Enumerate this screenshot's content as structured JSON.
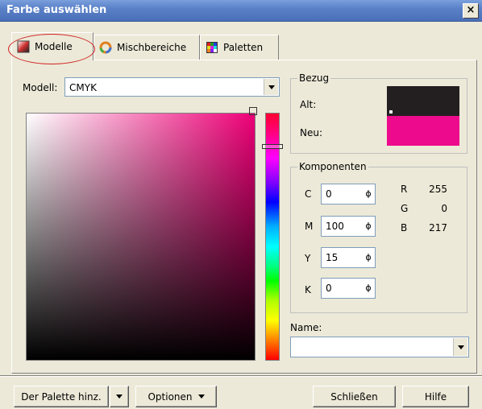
{
  "window": {
    "title": "Farbe auswählen",
    "close_glyph": "×"
  },
  "tabs": [
    {
      "label": "Modelle",
      "icon": "color-model-icon",
      "active": true
    },
    {
      "label": "Mischbereiche",
      "icon": "color-wheel-icon",
      "active": false
    },
    {
      "label": "Paletten",
      "icon": "palette-grid-icon",
      "active": false
    }
  ],
  "model": {
    "label": "Modell:",
    "selected": "CMYK"
  },
  "reference": {
    "group_label": "Bezug",
    "old_label": "Alt:",
    "new_label": "Neu:",
    "old_color": "#231f20",
    "new_color": "#ee0a8c"
  },
  "components": {
    "group_label": "Komponenten",
    "cmyk": [
      {
        "label": "C",
        "value": "0"
      },
      {
        "label": "M",
        "value": "100"
      },
      {
        "label": "Y",
        "value": "15"
      },
      {
        "label": "K",
        "value": "0"
      }
    ],
    "rgb": [
      {
        "label": "R",
        "value": "255"
      },
      {
        "label": "G",
        "value": "0"
      },
      {
        "label": "B",
        "value": "217"
      }
    ],
    "spin_glyph": "ɸ"
  },
  "name_field": {
    "label": "Name:",
    "value": ""
  },
  "buttons": {
    "add_to_palette": "Der Palette hinz.",
    "options": "Optionen",
    "close": "Schließen",
    "help": "Hilfe"
  },
  "colors": {
    "titlebar": "#5a81c8",
    "dialog_bg": "#ece9d8",
    "highlight_ellipse": "#d02020"
  }
}
